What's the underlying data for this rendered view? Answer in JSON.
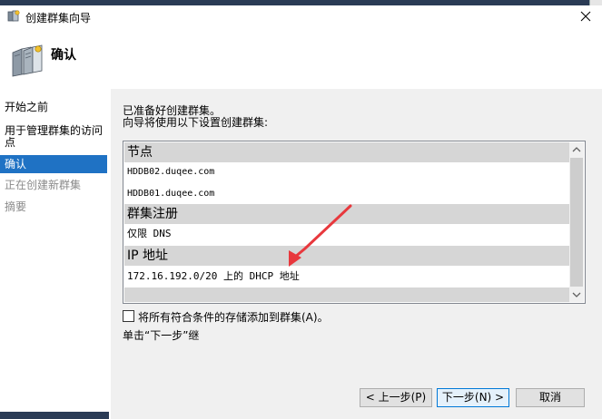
{
  "window": {
    "title": "创建群集向导"
  },
  "header": {
    "title": "确认"
  },
  "nav": {
    "items": [
      {
        "label": "开始之前"
      },
      {
        "label": "用于管理群集的访问"
      },
      {
        "label": "点"
      },
      {
        "label": "确认"
      },
      {
        "label": "正在创建新群集"
      },
      {
        "label": "摘要"
      }
    ]
  },
  "main": {
    "intro_line1": "已准备好创建群集。",
    "intro_line2": "向导将使用以下设置创建群集:",
    "sections": [
      {
        "header": "节点",
        "values": [
          "HDDB02.duqee.com",
          "HDDB01.duqee.com"
        ]
      },
      {
        "header": "群集注册",
        "values": [
          "仅限 DNS"
        ]
      },
      {
        "header": "IP 地址",
        "values": [
          "172.16.192.0/20 上的 DHCP 地址"
        ]
      }
    ],
    "checkbox_label": "将所有符合条件的存储添加到群集(A)。",
    "checkbox_checked": false,
    "hint": "单击“下一步”继"
  },
  "buttons": {
    "prev": "< 上一步(P)",
    "next": "下一步(N) >",
    "cancel": "取消"
  },
  "colors": {
    "nav_active": "#1f72c4",
    "annotation_arrow": "#e8383d"
  },
  "icons": [
    "wizard-icon",
    "close-icon",
    "cluster-servers-icon",
    "scroll-up-icon",
    "scroll-down-icon"
  ]
}
